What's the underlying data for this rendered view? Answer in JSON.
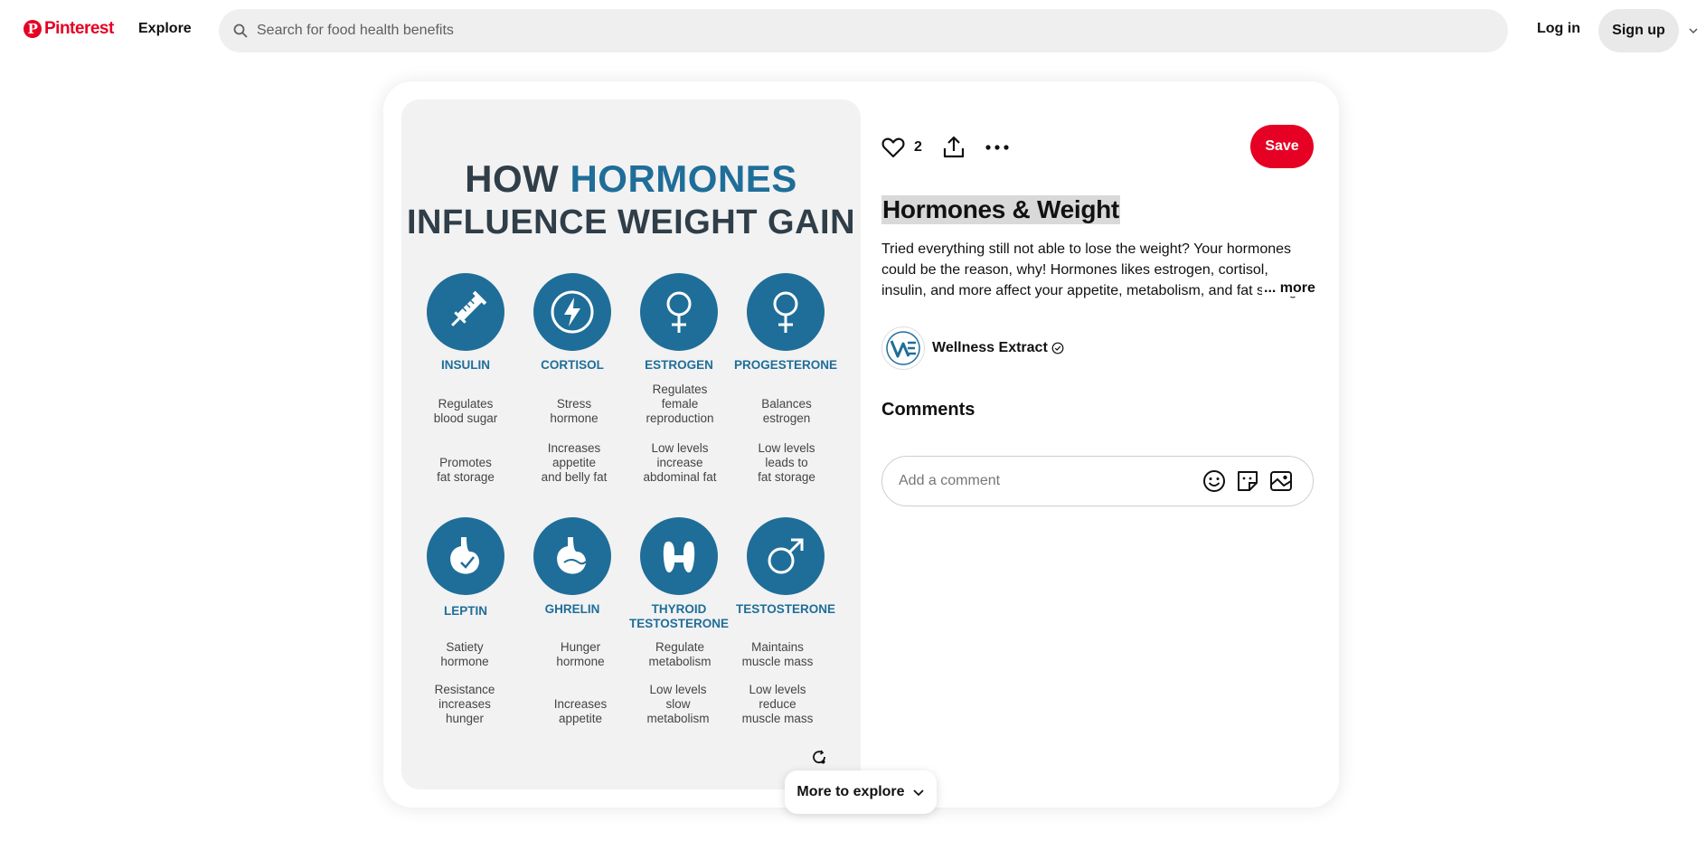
{
  "nav": {
    "brand": "Pinterest",
    "brand_mark": "P",
    "explore": "Explore",
    "search_placeholder": "Search for food health benefits",
    "login": "Log in",
    "signup": "Sign up"
  },
  "pin": {
    "likes": "2",
    "save": "Save",
    "title": "Hormones & Weight",
    "description": "Tried everything still not able to lose the weight? Your hormones could be the reason, why! Hormones likes estrogen, cortisol, insulin, and more affect your appetite, metabolism, and fat storage.",
    "more": "... more",
    "creator": {
      "name": "Wellness Extract"
    },
    "comments_heading": "Comments",
    "comment_placeholder": "Add a comment",
    "more_to_explore": "More to explore"
  },
  "infographic": {
    "title_prefix": "HOW ",
    "title_accent": "HORMONES",
    "title_line2": "INFLUENCE WEIGHT GAIN",
    "row1": [
      {
        "name": "INSULIN",
        "icon": "syringe-icon",
        "d1": "Regulates\nblood sugar",
        "d2": "Promotes\nfat storage"
      },
      {
        "name": "CORTISOL",
        "icon": "lightning-icon",
        "d1": "Stress\nhormone",
        "d2": "Increases\nappetite\nand belly fat"
      },
      {
        "name": "ESTROGEN",
        "icon": "female-icon",
        "d1": "Regulates\nfemale\nreproduction",
        "d2": "Low levels\nincrease\nabdominal fat"
      },
      {
        "name": "PROGESTERONE",
        "icon": "female-icon",
        "d1": "Balances\nestrogen",
        "d2": "Low levels\nleads to\nfat storage"
      }
    ],
    "row2": [
      {
        "name": "LEPTIN",
        "icon": "stomach-check-icon",
        "d1": "Satiety\nhormone",
        "d2": "Resistance\nincreases\nhunger"
      },
      {
        "name": "GHRELIN",
        "icon": "stomach-icon",
        "d1": "Hunger\nhormone",
        "d2": "Increases\nappetite"
      },
      {
        "name": "THYROID\nTESTOSTERONE",
        "icon": "thyroid-icon",
        "d1": "Regulate\nmetabolism",
        "d2": "Low levels\nslow\nmetabolism"
      },
      {
        "name": "TESTOSTERONE",
        "icon": "male-icon",
        "d1": "Maintains\nmuscle mass",
        "d2": "Low levels\nreduce\nmuscle mass"
      }
    ]
  }
}
